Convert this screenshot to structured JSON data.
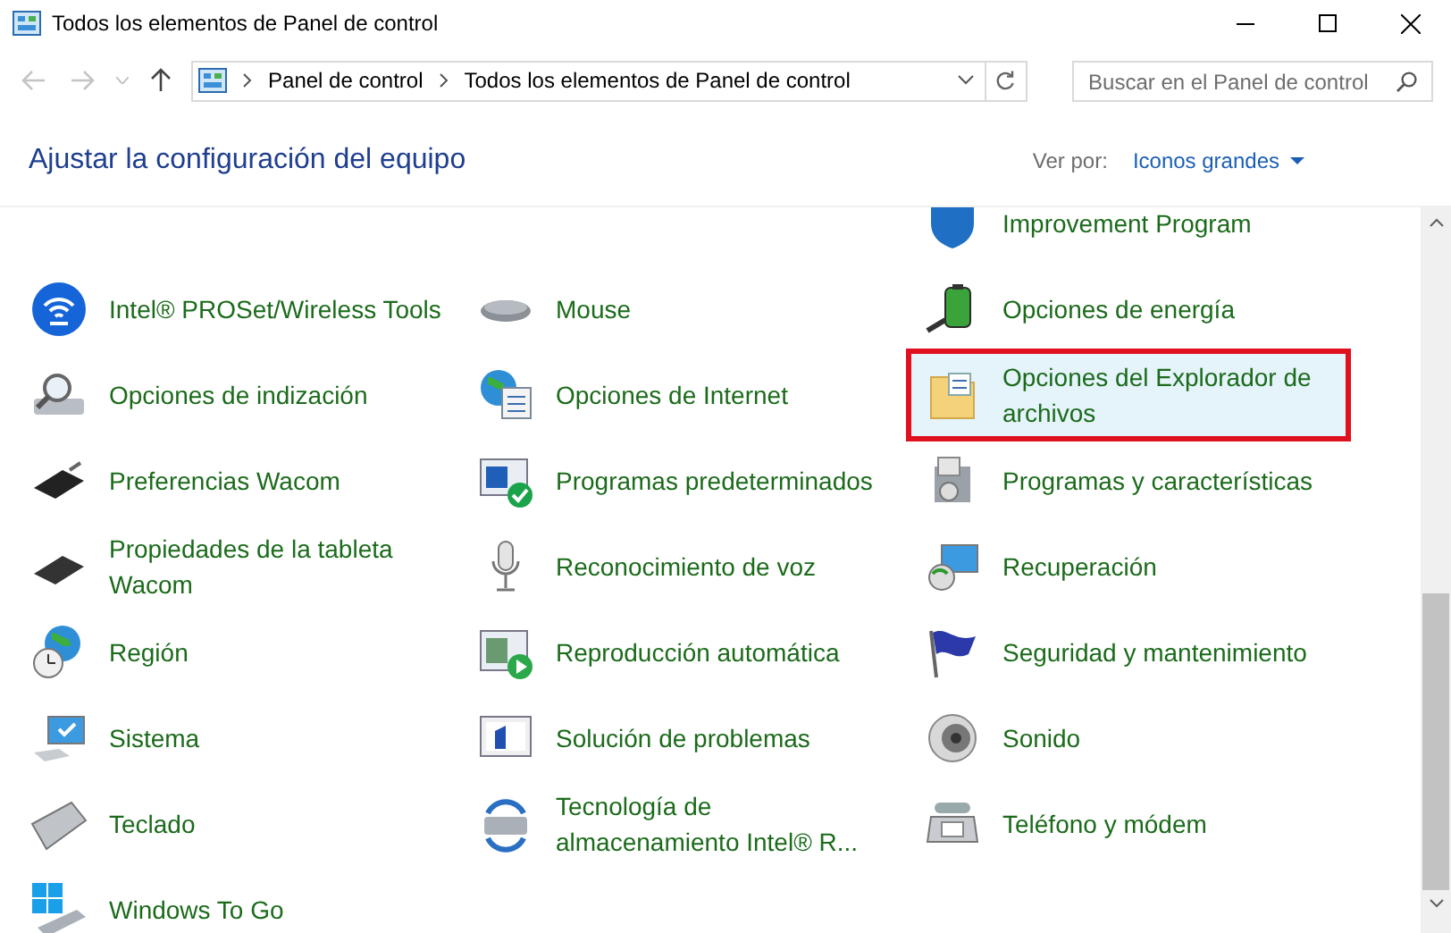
{
  "window": {
    "title": "Todos los elementos de Panel de control"
  },
  "address_bar": {
    "path": [
      "Panel de control",
      "Todos los elementos de Panel de control"
    ]
  },
  "search": {
    "placeholder": "Buscar en el Panel de control"
  },
  "heading": "Ajustar la configuración del equipo",
  "view_by": {
    "label": "Ver por:",
    "value": "Iconos grandes"
  },
  "items": [
    {
      "label": "Improvement Program",
      "selected": false,
      "annotated": false
    },
    {
      "label": "Intel® PROSet/Wireless Tools",
      "selected": false,
      "annotated": false
    },
    {
      "label": "Mouse",
      "selected": false,
      "annotated": false
    },
    {
      "label": "Opciones de energía",
      "selected": false,
      "annotated": false
    },
    {
      "label": "Opciones de indización",
      "selected": false,
      "annotated": false
    },
    {
      "label": "Opciones de Internet",
      "selected": false,
      "annotated": false
    },
    {
      "label": "Opciones del Explorador de archivos",
      "selected": true,
      "annotated": true
    },
    {
      "label": "Preferencias Wacom",
      "selected": false,
      "annotated": false
    },
    {
      "label": "Programas predeterminados",
      "selected": false,
      "annotated": false
    },
    {
      "label": "Programas y características",
      "selected": false,
      "annotated": false
    },
    {
      "label": "Propiedades de la tableta Wacom",
      "selected": false,
      "annotated": false
    },
    {
      "label": "Reconocimiento de voz",
      "selected": false,
      "annotated": false
    },
    {
      "label": "Recuperación",
      "selected": false,
      "annotated": false
    },
    {
      "label": "Región",
      "selected": false,
      "annotated": false
    },
    {
      "label": "Reproducción automática",
      "selected": false,
      "annotated": false
    },
    {
      "label": "Seguridad y mantenimiento",
      "selected": false,
      "annotated": false
    },
    {
      "label": "Sistema",
      "selected": false,
      "annotated": false
    },
    {
      "label": "Solución de problemas",
      "selected": false,
      "annotated": false
    },
    {
      "label": "Sonido",
      "selected": false,
      "annotated": false
    },
    {
      "label": "Teclado",
      "selected": false,
      "annotated": false
    },
    {
      "label": "Tecnología de almacenamiento Intel® R...",
      "selected": false,
      "annotated": false
    },
    {
      "label": "Teléfono y módem",
      "selected": false,
      "annotated": false
    },
    {
      "label": "Windows To Go",
      "selected": false,
      "annotated": false
    }
  ]
}
